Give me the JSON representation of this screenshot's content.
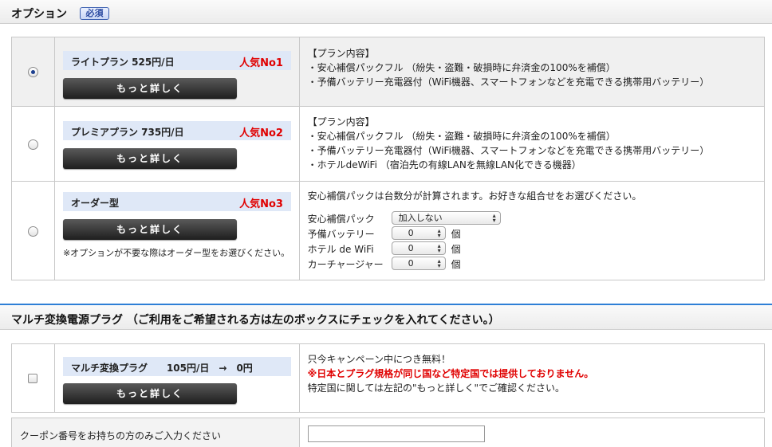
{
  "section1": {
    "title": "オプション",
    "badge": "必須"
  },
  "plans": [
    {
      "name": "ライトプラン 525円/日",
      "rank": "人気No1",
      "more_button": "もっと詳しく",
      "selected": true,
      "details": [
        "【プラン内容】",
        "・安心補償パックフル （紛失・盗難・破損時に弁済金の100%を補償）",
        "・予備バッテリー充電器付（WiFi機器、スマートフォンなどを充電できる携帯用バッテリー）"
      ]
    },
    {
      "name": "プレミアプラン 735円/日",
      "rank": "人気No2",
      "more_button": "もっと詳しく",
      "selected": false,
      "details": [
        "【プラン内容】",
        "・安心補償パックフル （紛失・盗難・破損時に弁済金の100%を補償）",
        "・予備バッテリー充電器付（WiFi機器、スマートフォンなどを充電できる携帯用バッテリー）",
        "・ホテルdeWiFi （宿泊先の有線LANを無線LAN化できる機器）"
      ]
    },
    {
      "name": "オーダー型",
      "rank": "人気No3",
      "more_button": "もっと詳しく",
      "selected": false,
      "note": "※オプションが不要な際はオーダー型をお選びください。",
      "intro": "安心補償パックは台数分が計算されます。お好きな組合せをお選びください。",
      "fields": [
        {
          "label": "安心補償パック",
          "value": "加入しない",
          "unit": ""
        },
        {
          "label": "予備バッテリー",
          "value": "0",
          "unit": "個"
        },
        {
          "label": "ホテル de WiFi",
          "value": "0",
          "unit": "個"
        },
        {
          "label": "カーチャージャー",
          "value": "0",
          "unit": "個"
        }
      ]
    }
  ],
  "section2": {
    "title": "マルチ変換電源プラグ （ご利用をご希望される方は左のボックスにチェックを入れてください。）"
  },
  "plug": {
    "name": "マルチ変換プラグ　　105円/日　→　0円",
    "more_button": "もっと詳しく",
    "line1": "只今キャンペーン中につき無料！",
    "line2": "※日本とプラグ規格が同じ国など特定国では提供しておりません。",
    "line3": "特定国に関しては左記の\"もっと詳しく\"でご確認ください。"
  },
  "coupon": {
    "label": "クーポン番号をお持ちの方のみご入力ください",
    "value": ""
  }
}
